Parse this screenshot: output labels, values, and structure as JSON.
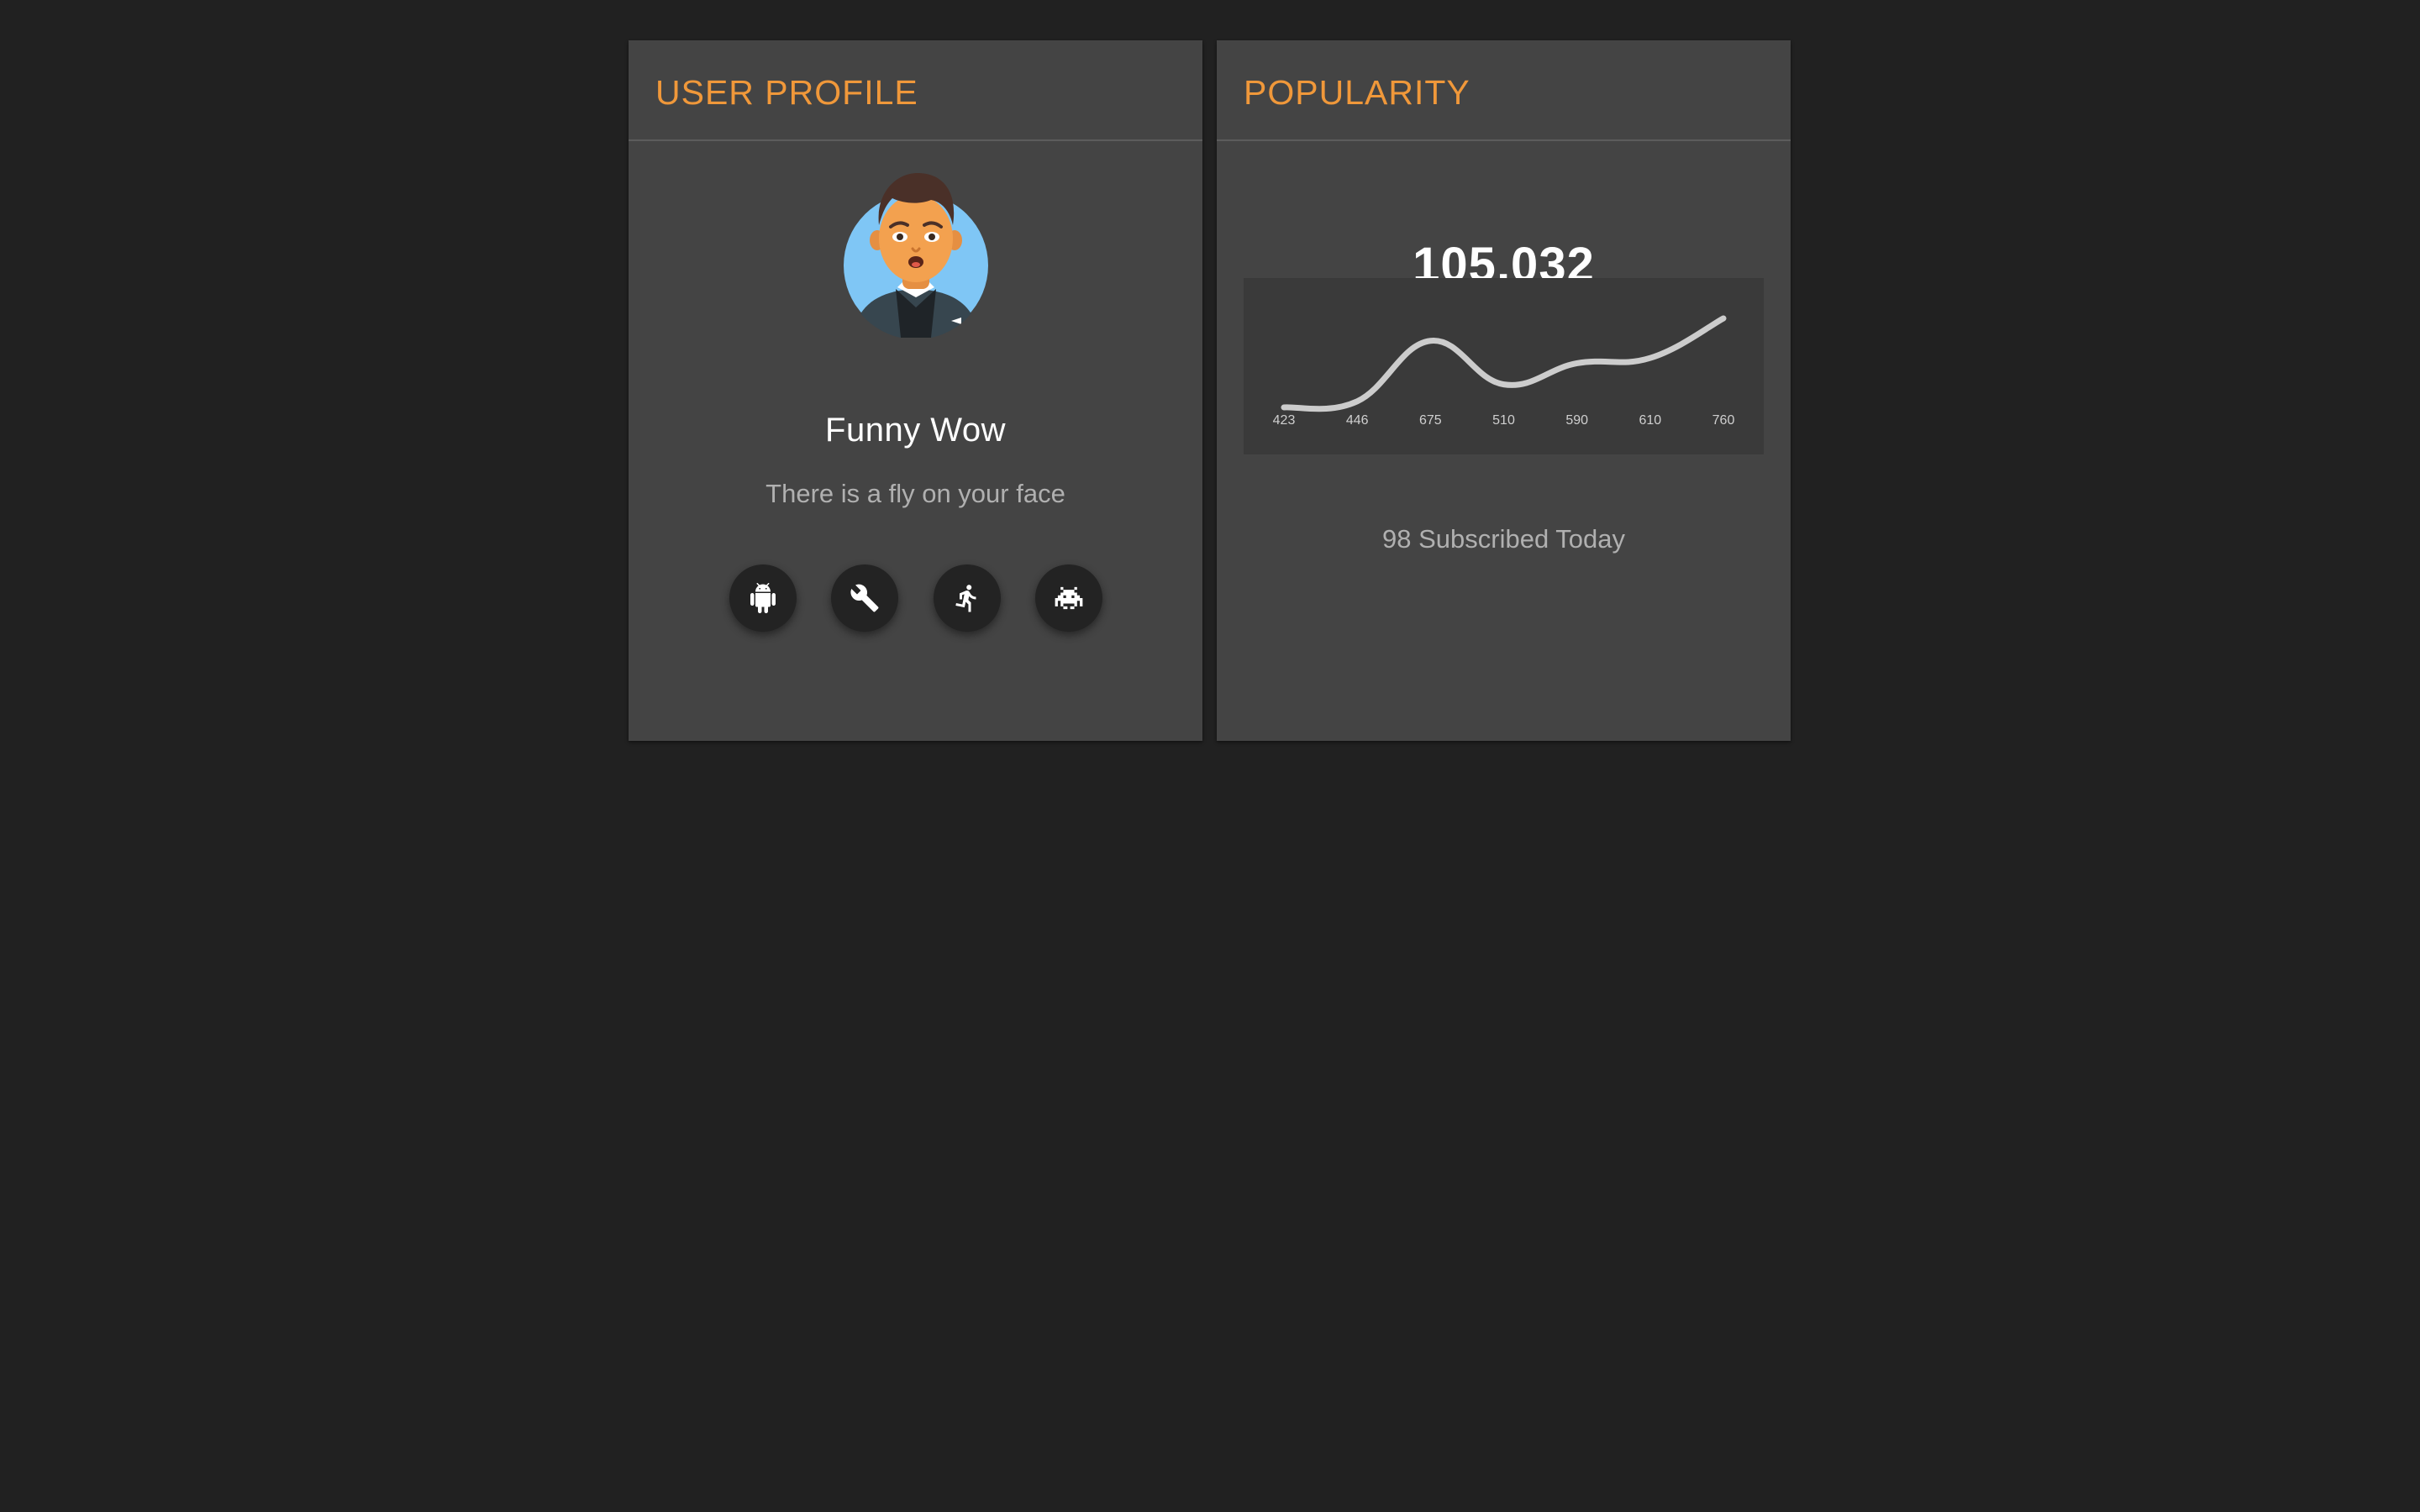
{
  "profile_card": {
    "title": "USER PROFILE",
    "user": {
      "name": "Funny Wow",
      "status": "There is a fly on your face"
    },
    "actions": [
      {
        "icon": "android-icon"
      },
      {
        "icon": "wrench-icon"
      },
      {
        "icon": "running-person-icon"
      },
      {
        "icon": "space-invader-icon"
      }
    ]
  },
  "popularity_card": {
    "title": "POPULARITY",
    "total": "105,032",
    "subscribed_text": "98 Subscribed Today"
  },
  "colors": {
    "background": "#212121",
    "card": "#444444",
    "accent": "#f0983a",
    "chart_line": "#cccccc"
  },
  "chart_data": {
    "type": "line",
    "categories": [
      "423",
      "446",
      "675",
      "510",
      "590",
      "610",
      "760"
    ],
    "values": [
      423,
      446,
      675,
      510,
      590,
      610,
      760
    ],
    "ylim": [
      423,
      760
    ],
    "grid": false,
    "smooth": true
  }
}
